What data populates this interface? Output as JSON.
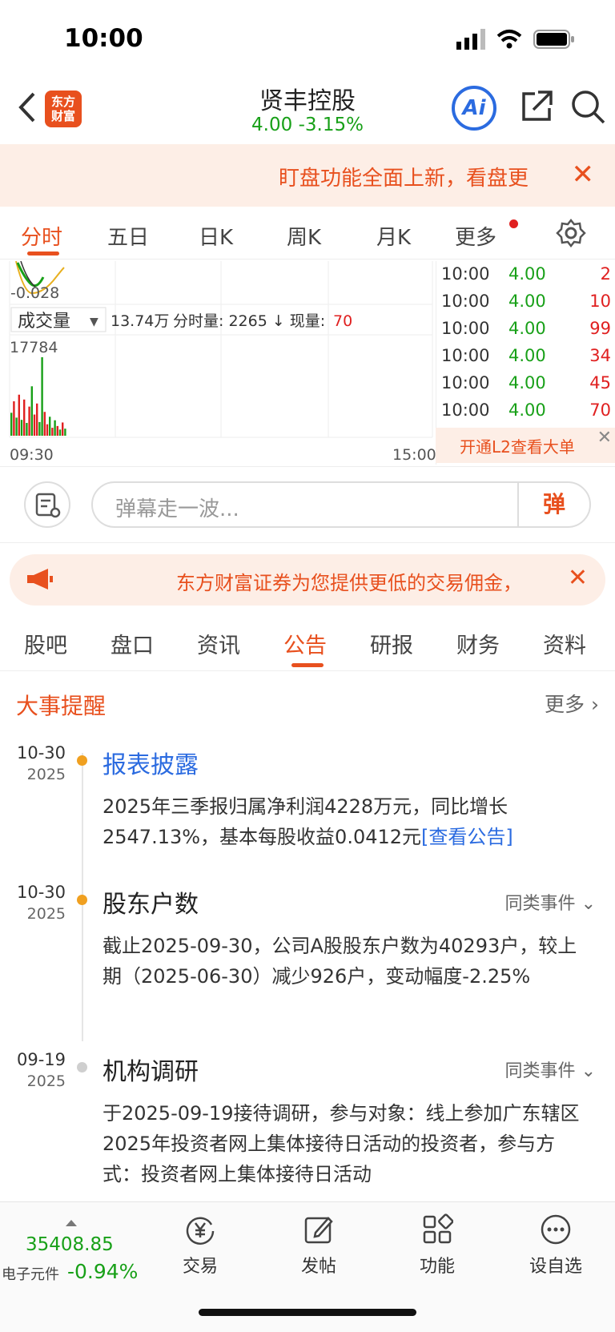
{
  "status_bar": {
    "time": "10:00"
  },
  "header": {
    "logo_text_1": "东方",
    "logo_text_2": "财富",
    "stock_name": "贤丰控股",
    "price_line": "4.00  -3.15%",
    "ai_label": "Ai"
  },
  "notice": {
    "text": "盯盘功能全面上新，看盘更",
    "close": "✕"
  },
  "chart_tabs": [
    {
      "label": "分时",
      "active": true
    },
    {
      "label": "五日"
    },
    {
      "label": "日K"
    },
    {
      "label": "周K"
    },
    {
      "label": "月K"
    },
    {
      "label": "更多"
    }
  ],
  "chart": {
    "price_axis_label": "-0.028",
    "volume_selector": "成交量",
    "volume_total": "13.74万",
    "volume_info_label": "分时量: 2265 ↓ 现量:",
    "current_volume": "70",
    "max_volume_label": "17784",
    "time_start": "09:30",
    "time_end": "15:00",
    "bar_color_up": "#e02020",
    "bar_color_down": "#18a018"
  },
  "chart_data": {
    "type": "bar",
    "title": "",
    "xlabel": "",
    "ylabel": "",
    "x_range": [
      "09:30",
      "15:00"
    ],
    "max_label": 17784,
    "series": [
      {
        "values": [
          5200,
          7800,
          4100,
          9300,
          3600,
          8200,
          2900,
          6600,
          11200,
          4800,
          7300,
          3100,
          17784,
          5400,
          2600,
          4300,
          1800,
          3500,
          2200,
          1400,
          3000,
          1600
        ]
      }
    ],
    "colors": [
      "g",
      "r",
      "g",
      "r",
      "g",
      "r",
      "g",
      "r",
      "g",
      "r",
      "r",
      "g",
      "g",
      "r",
      "r",
      "g",
      "r",
      "g",
      "r",
      "g",
      "r",
      "g"
    ]
  },
  "ticks": [
    {
      "time": "10:00",
      "price": "4.00",
      "vol": "2"
    },
    {
      "time": "10:00",
      "price": "4.00",
      "vol": "10"
    },
    {
      "time": "10:00",
      "price": "4.00",
      "vol": "99"
    },
    {
      "time": "10:00",
      "price": "4.00",
      "vol": "34"
    },
    {
      "time": "10:00",
      "price": "4.00",
      "vol": "45"
    },
    {
      "time": "10:00",
      "price": "4.00",
      "vol": "70"
    }
  ],
  "l2": {
    "text": "开通L2查看大单",
    "close": "✕"
  },
  "danmu": {
    "placeholder": "弹幕走一波...",
    "send_label": "弹"
  },
  "promo": {
    "text": "东方财富证券为您提供更低的交易佣金，",
    "close": "✕"
  },
  "info_tabs": [
    "股吧",
    "盘口",
    "资讯",
    "公告",
    "研报",
    "财务",
    "资料"
  ],
  "events": {
    "title": "大事提醒",
    "more": "更多",
    "items": [
      {
        "date": "10-30",
        "year": "2025",
        "title": "报表披露",
        "similar": "",
        "body": "2025年三季报归属净利润4228万元，同比增长2547.13%，基本每股收益0.0412元",
        "link": "[查看公告]"
      },
      {
        "date": "10-30",
        "year": "2025",
        "title": "股东户数",
        "similar": "同类事件",
        "body": "截止2025-09-30，公司A股股东户数为40293户，较上期（2025-06-30）减少926户，变动幅度-2.25%",
        "link": ""
      },
      {
        "date": "09-19",
        "year": "2025",
        "title": "机构调研",
        "similar": "同类事件",
        "body": "于2025-09-19接待调研，参与对象：线上参加广东辖区2025年投资者网上集体接待日活动的投资者，参与方式：投资者网上集体接待日活动",
        "link": ""
      }
    ]
  },
  "bottom": {
    "index_value": "35408.85",
    "index_name": "电子元件",
    "index_change": "-0.94%",
    "nav": [
      {
        "label": "交易"
      },
      {
        "label": "发帖"
      },
      {
        "label": "功能"
      },
      {
        "label": "设自选"
      }
    ]
  }
}
